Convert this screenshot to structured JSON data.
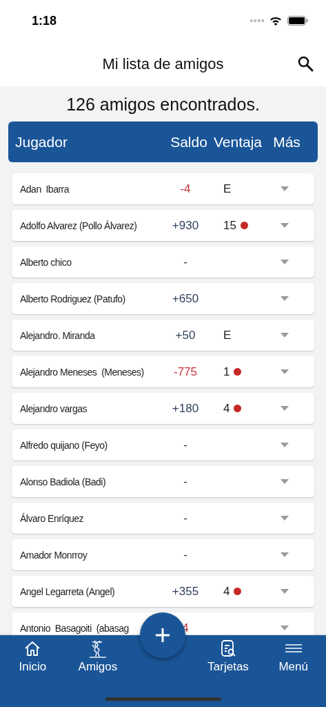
{
  "status_bar": {
    "time": "1:18"
  },
  "header": {
    "title": "Mi lista de amigos"
  },
  "count": "126 amigos encontrados.",
  "table": {
    "columns": [
      "Jugador",
      "Saldo",
      "Ventaja",
      "Más"
    ],
    "rows": [
      {
        "name": "Adan  Ibarra",
        "saldo": {
          "text": "-4",
          "color": "#c8323c"
        },
        "ventaja": "E",
        "marked": false
      },
      {
        "name": "Adolfo Alvarez (Pollo Álvarez)",
        "saldo": {
          "text": "+930",
          "color": "#2f3f5c"
        },
        "ventaja": "15",
        "marked": true
      },
      {
        "name": "Alberto chico",
        "saldo": {
          "text": "-",
          "color": "#333333"
        },
        "marked": false
      },
      {
        "name": "Alberto Rodriguez (Patufo)",
        "saldo": {
          "text": "+650",
          "color": "#2f3f5c"
        },
        "marked": false
      },
      {
        "name": "Alejandro. Miranda",
        "saldo": {
          "text": "+50",
          "color": "#2f3f5c"
        },
        "ventaja": "E",
        "marked": false
      },
      {
        "name": "Alejandro Meneses  (Meneses)",
        "saldo": {
          "text": "-775",
          "color": "#c8323c"
        },
        "ventaja": "1",
        "marked": true
      },
      {
        "name": "Alejandro vargas",
        "saldo": {
          "text": "+180",
          "color": "#2f3f5c"
        },
        "ventaja": "4",
        "marked": true
      },
      {
        "name": "Alfredo quijano (Feyo)",
        "saldo": {
          "text": "-",
          "color": "#333333"
        },
        "marked": false
      },
      {
        "name": "Alonso Badiola (Badi)",
        "saldo": {
          "text": "-",
          "color": "#333333"
        },
        "marked": false
      },
      {
        "name": "Álvaro Enríquez",
        "saldo": {
          "text": "-",
          "color": "#333333"
        },
        "marked": false
      },
      {
        "name": "Amador Monrroy",
        "saldo": {
          "text": "-",
          "color": "#333333"
        },
        "marked": false
      },
      {
        "name": "Angel Legarreta (Angel)",
        "saldo": {
          "text": "+355",
          "color": "#2f3f5c"
        },
        "ventaja": "4",
        "marked": true
      },
      {
        "name": "Antonio  Basagoiti  (abasag",
        "saldo": {
          "text": "4",
          "color": "#c8323c"
        },
        "marked": false
      }
    ]
  },
  "nav": {
    "items": [
      {
        "label": "Inicio"
      },
      {
        "label": "Amigos"
      },
      {
        "label": "Tarjetas"
      },
      {
        "label": "Menú"
      }
    ]
  }
}
